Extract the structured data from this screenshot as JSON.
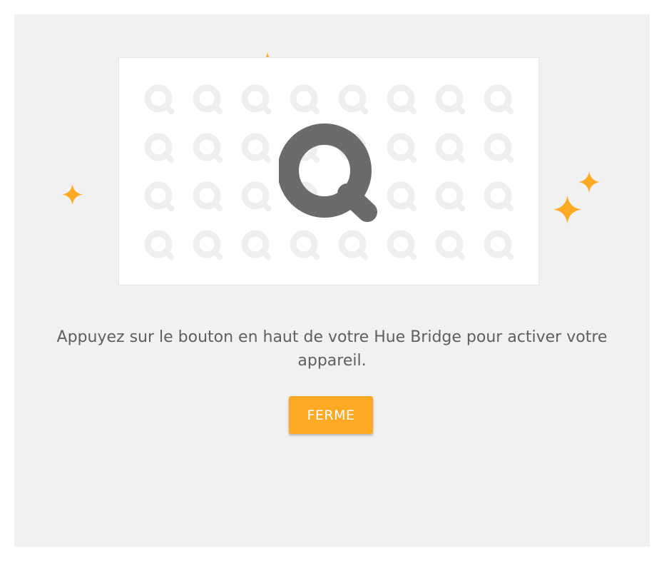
{
  "dialog": {
    "message": "Appuyez sur le bouton en haut de votre Hue Bridge pour activer votre appareil.",
    "button_label": "FERME"
  },
  "illustration": {
    "main_icon": "bridge-q-icon",
    "pattern_icon": "q-pattern-icon",
    "sparkle_icon": "sparkle-icon",
    "pattern_rows": 4,
    "pattern_cols": 8
  },
  "colors": {
    "panel_background": "#f1f1f1",
    "accent": "#ffa925",
    "main_icon": "#6b6b6b",
    "pattern_icon": "#efefef",
    "text": "#5f5f5f"
  }
}
